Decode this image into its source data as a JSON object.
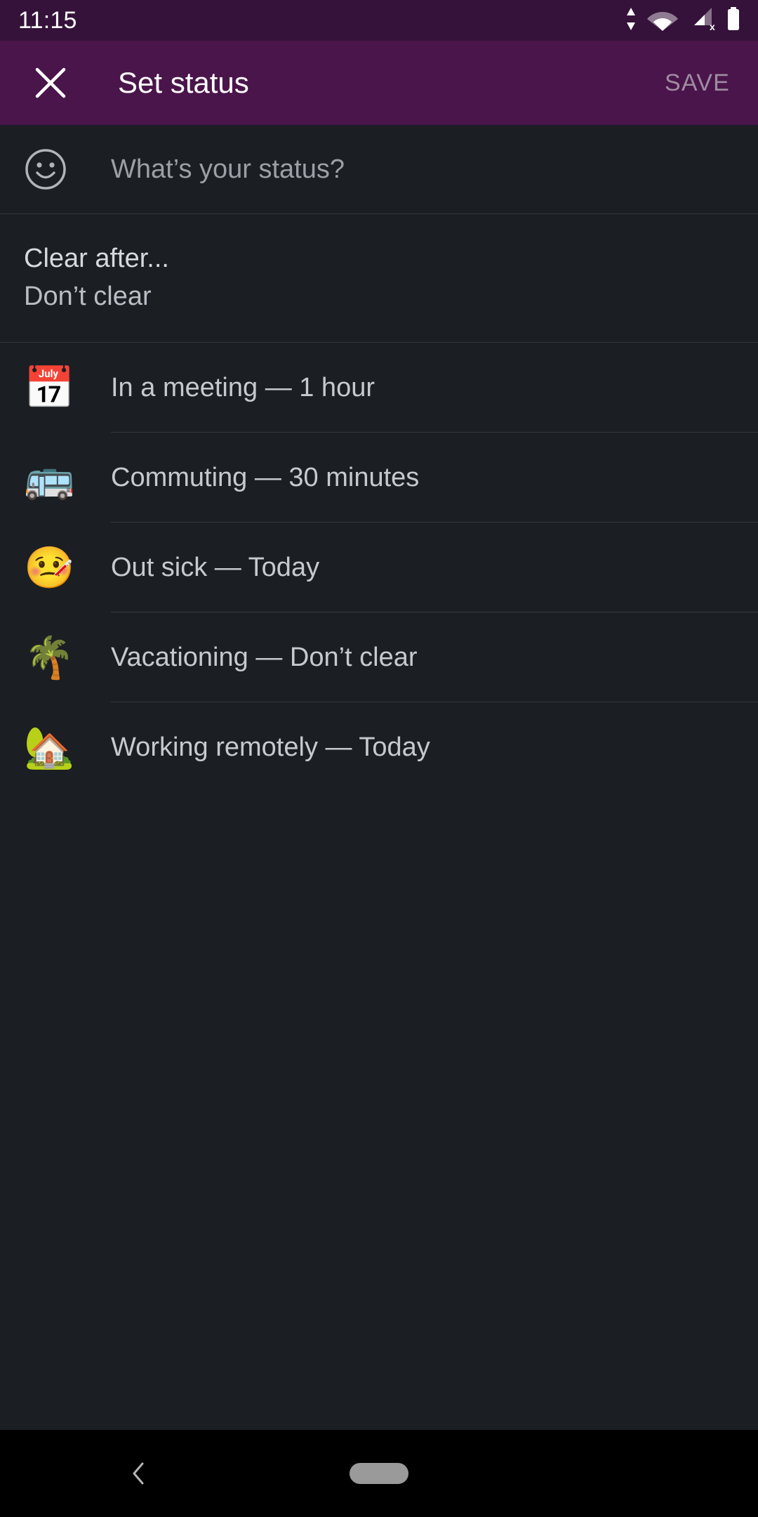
{
  "status_bar": {
    "time": "11:15",
    "icons": [
      "data-transfer-icon",
      "wifi-icon",
      "cellular-no-sim-icon",
      "battery-full-icon"
    ]
  },
  "app_bar": {
    "close_label": "×",
    "title": "Set status",
    "save_label": "SAVE",
    "background": "#4a154b"
  },
  "status_input": {
    "emoji_icon": "smiley-outline-icon",
    "value": "",
    "placeholder": "What’s your status?"
  },
  "clear_after": {
    "label": "Clear after...",
    "value": "Don’t clear"
  },
  "presets": [
    {
      "emoji": "📅",
      "emoji_name": "calendar-emoji",
      "label": "In a meeting — 1 hour"
    },
    {
      "emoji": "🚌",
      "emoji_name": "bus-emoji",
      "label": "Commuting — 30 minutes"
    },
    {
      "emoji": "🤒",
      "emoji_name": "sick-face-emoji",
      "label": "Out sick — Today"
    },
    {
      "emoji": "🌴",
      "emoji_name": "palm-tree-emoji",
      "label": "Vacationing — Don’t clear"
    },
    {
      "emoji": "🏡",
      "emoji_name": "house-garden-emoji",
      "label": "Working remotely — Today"
    }
  ],
  "nav_bar": {
    "back_label": "back-icon",
    "home_label": "home-pill"
  },
  "colors": {
    "brand_purple": "#4a154b",
    "status_bar_purple": "#35123a",
    "page_background": "#1b1e23",
    "divider": "#35393f",
    "primary_text": "#d7dadd",
    "muted_text": "#9aa0a6"
  }
}
